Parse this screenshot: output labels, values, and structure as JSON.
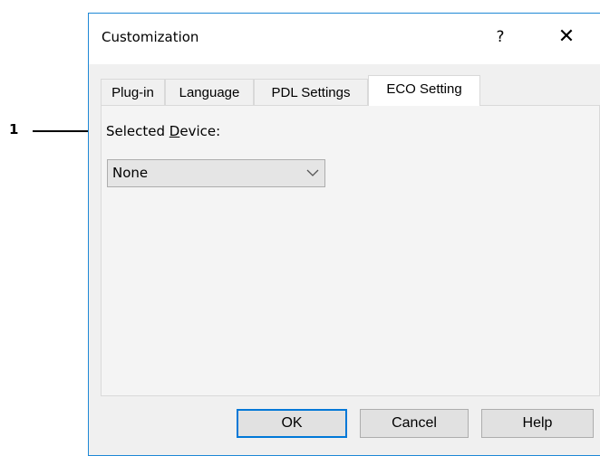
{
  "callout": {
    "number": "1"
  },
  "dialog": {
    "title": "Customization",
    "help_glyph": "?",
    "close_glyph": "✕",
    "tabs": [
      {
        "label": "Plug-in",
        "active": false
      },
      {
        "label": "Language",
        "active": false
      },
      {
        "label": "PDL Settings",
        "active": false
      },
      {
        "label": "ECO Setting",
        "active": true
      }
    ],
    "selected_device": {
      "label_pre": "Selected ",
      "label_accel": "D",
      "label_post": "evice:",
      "value": "None",
      "dropdown_icon": "chevron-down-icon"
    },
    "buttons": {
      "ok": "OK",
      "cancel": "Cancel",
      "help": "Help"
    }
  },
  "colors": {
    "accent_border": "#1e88d6",
    "default_button_border": "#0078d7",
    "dialog_background": "#f0f0f0"
  }
}
